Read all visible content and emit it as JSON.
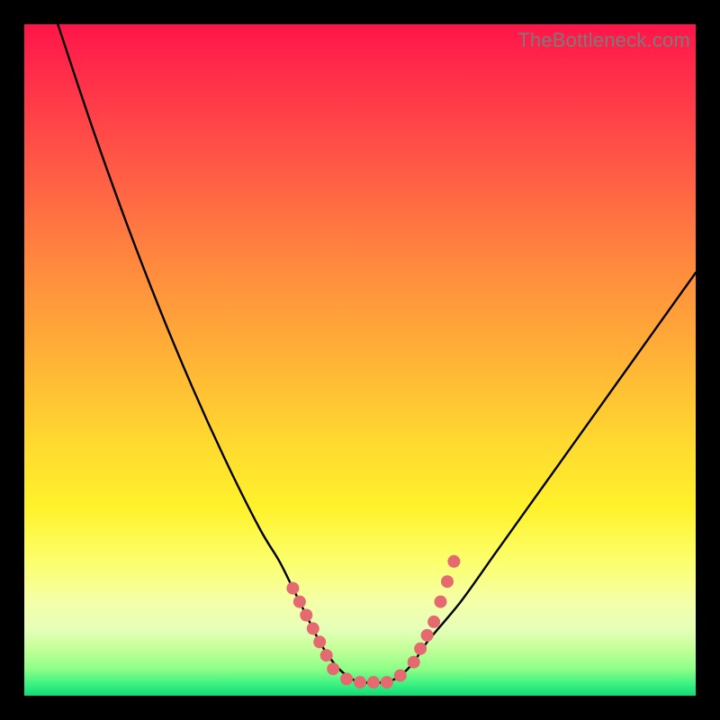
{
  "watermark": "TheBottleneck.com",
  "chart_data": {
    "type": "line",
    "title": "",
    "xlabel": "",
    "ylabel": "",
    "xlim": [
      0,
      100
    ],
    "ylim": [
      0,
      100
    ],
    "note": "V-shaped bottleneck curve on a red→yellow→green vertical gradient. Minimum (best match) is a flat plateau near x≈48–55 at y≈98. Pink markers cluster on both slopes near the minimum.",
    "series": [
      {
        "name": "bottleneck-curve",
        "x": [
          5,
          10,
          15,
          20,
          25,
          30,
          35,
          38,
          40,
          42,
          44,
          46,
          48,
          50,
          52,
          54,
          56,
          58,
          60,
          65,
          70,
          75,
          80,
          85,
          90,
          95,
          100
        ],
        "y": [
          0,
          15,
          29,
          42,
          54,
          65,
          75,
          80,
          84,
          88,
          92,
          95,
          97,
          98,
          98,
          98,
          97,
          95,
          92,
          86,
          79,
          72,
          65,
          58,
          51,
          44,
          37
        ]
      }
    ],
    "markers": {
      "name": "sample-points",
      "color": "#e46a6f",
      "points_xy": [
        [
          40,
          84
        ],
        [
          41,
          86
        ],
        [
          42,
          88
        ],
        [
          43,
          90
        ],
        [
          44,
          92
        ],
        [
          45,
          94
        ],
        [
          46,
          96
        ],
        [
          48,
          97.5
        ],
        [
          50,
          98
        ],
        [
          52,
          98
        ],
        [
          54,
          98
        ],
        [
          56,
          97
        ],
        [
          58,
          95
        ],
        [
          59,
          93
        ],
        [
          60,
          91
        ],
        [
          61,
          89
        ],
        [
          62,
          86
        ],
        [
          63,
          83
        ],
        [
          64,
          80
        ]
      ]
    },
    "gradient_stops": [
      {
        "pos": 0,
        "color": "#ff1549"
      },
      {
        "pos": 0.5,
        "color": "#ffb336"
      },
      {
        "pos": 0.8,
        "color": "#fcff6c"
      },
      {
        "pos": 1.0,
        "color": "#10d877"
      }
    ]
  }
}
